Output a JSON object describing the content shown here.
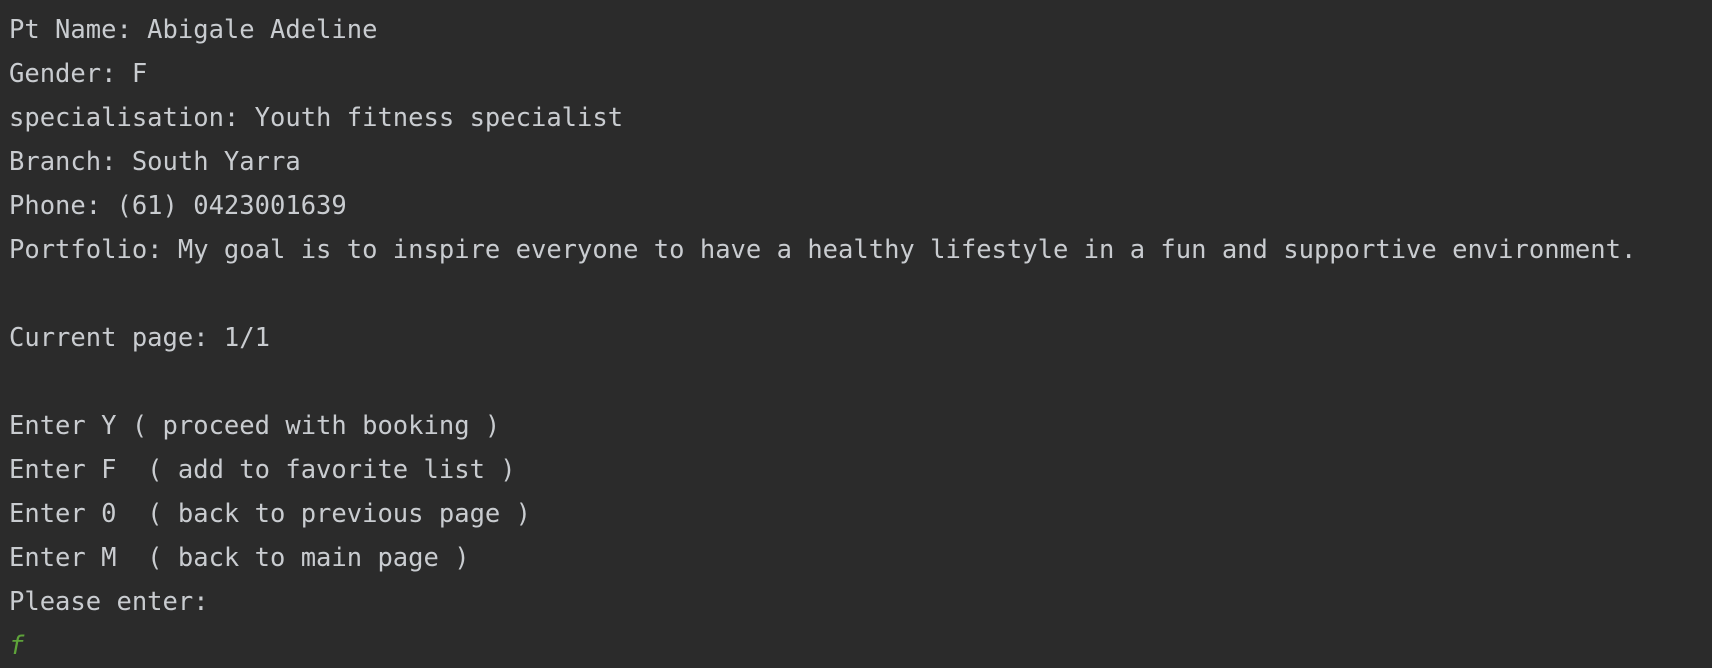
{
  "console": {
    "lines": [
      "Pt Name: Abigale Adeline",
      "Gender: F",
      "specialisation: Youth fitness specialist",
      "Branch: South Yarra",
      "Phone: (61) 0423001639",
      "Portfolio: My goal is to inspire everyone to have a healthy lifestyle in a fun and supportive environment.",
      "",
      "Current page: 1/1",
      "",
      "Enter Y ( proceed with booking )",
      "Enter F  ( add to favorite list )",
      "Enter 0  ( back to previous page )",
      "Enter M  ( back to main page )",
      "Please enter:"
    ],
    "user_input": "f"
  },
  "colors": {
    "background": "#2b2b2b",
    "text": "#c9ccd0",
    "user_input": "#5ea33a"
  }
}
